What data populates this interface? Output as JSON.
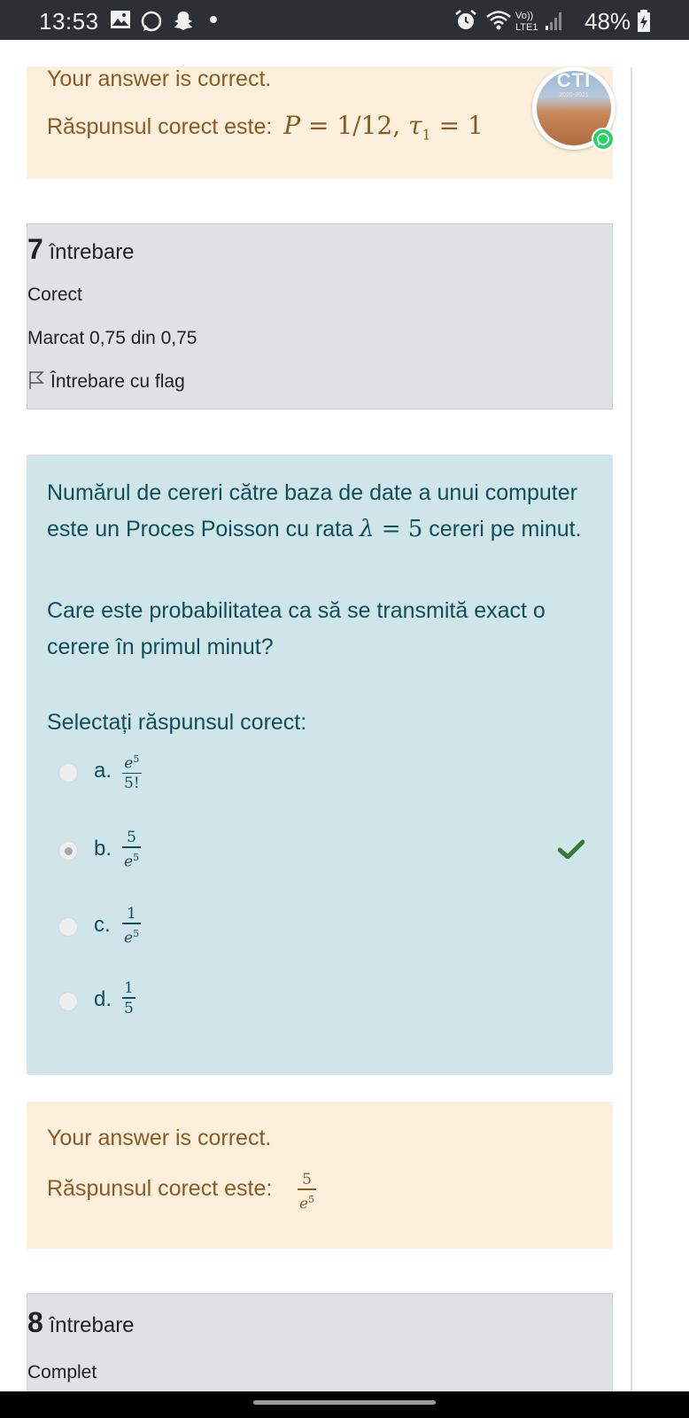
{
  "status_bar": {
    "time": "13:53",
    "battery": "48%",
    "network": "Vo)) LTE1"
  },
  "feedback_top": {
    "correct_text": "Your answer is correct.",
    "answer_prefix": "Răspunsul corect este:",
    "answer_formula": "P = 1/12, τ1 = 1"
  },
  "avatar": {
    "title": "CTI",
    "subtitle": "2020-2021"
  },
  "question7_info": {
    "number": "7",
    "label": "întrebare",
    "state": "Corect",
    "grade": "Marcat 0,75 din 0,75",
    "flag": "Întrebare cu flag"
  },
  "question7": {
    "text_part1": "Numărul de cereri către baza de date a unui computer este un Proces Poisson cu rata",
    "rate_formula": "λ = 5",
    "text_part2": "cereri pe minut.",
    "text2": "Care este probabilitatea ca să se transmită exact o cerere în primul minut?",
    "prompt": "Selectați răspunsul corect:",
    "options": [
      {
        "letter": "a.",
        "num": "e5",
        "den": "5!",
        "selected": false
      },
      {
        "letter": "b.",
        "num": "5",
        "den": "e5",
        "selected": true,
        "correct": true
      },
      {
        "letter": "c.",
        "num": "1",
        "den": "e5",
        "selected": false
      },
      {
        "letter": "d.",
        "num": "1",
        "den": "5",
        "selected": false
      }
    ]
  },
  "feedback_q7": {
    "correct_text": "Your answer is correct.",
    "answer_prefix": "Răspunsul corect este:",
    "answer_num": "5",
    "answer_den": "e5"
  },
  "question8_info": {
    "number": "8",
    "label": "întrebare",
    "state": "Complet"
  },
  "colors": {
    "feedback_bg": "#fcefdc",
    "feedback_text": "#8a5a22",
    "info_bg": "#dee2e6",
    "question_bg": "#cfe5ea",
    "question_text": "#0f4f5a",
    "check_green": "#357a32"
  }
}
